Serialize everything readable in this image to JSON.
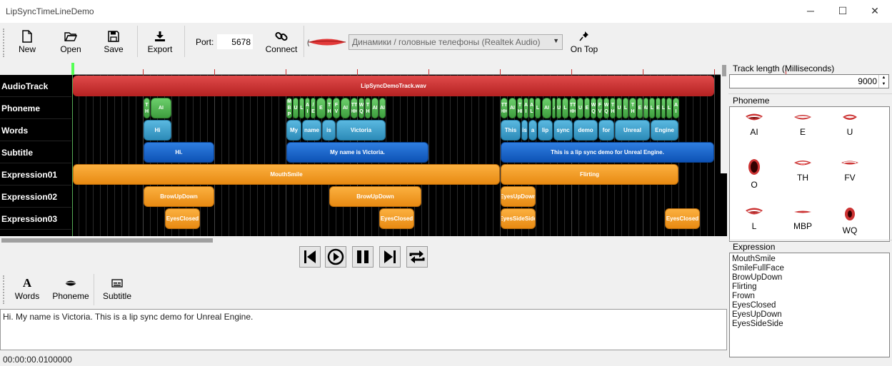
{
  "window": {
    "title": "LipSyncTimeLineDemo",
    "minimize": "─",
    "maximize": "☐",
    "close": "✕"
  },
  "toolbar": {
    "new_label": "New",
    "open_label": "Open",
    "save_label": "Save",
    "export_label": "Export",
    "port_label": "Port:",
    "port_value": "5678",
    "connect_label": "Connect",
    "audio_device": "Динамики / головные телефоны (Realtek Audio)",
    "ontop_label": "On Top"
  },
  "tracks": {
    "audio": "AudioTrack",
    "phoneme": "Phoneme",
    "words": "Words",
    "subtitle": "Subtitle",
    "expr1": "Expression01",
    "expr2": "Expression02",
    "expr3": "Expression03"
  },
  "clips": {
    "audio": "LipSyncDemoTrack.wav",
    "phonemes": [
      {
        "t": "T\nH"
      },
      {
        "t": "AI"
      },
      {
        "t": "M\nB\nP"
      },
      {
        "t": "U"
      },
      {
        "t": "L"
      },
      {
        "t": "A\nI"
      },
      {
        "t": "/\nE"
      },
      {
        "t": "E"
      },
      {
        "t": "T\nH"
      },
      {
        "t": "F\nV"
      },
      {
        "t": "AI"
      },
      {
        "t": "TT\nHH"
      },
      {
        "t": "W\nQ"
      },
      {
        "t": "T\nH"
      },
      {
        "t": "AI"
      },
      {
        "t": "AI"
      },
      {
        "t": "TT\nHH"
      },
      {
        "t": "AI"
      },
      {
        "t": "T\nHI"
      },
      {
        "t": "A\nI"
      },
      {
        "t": "A\nL"
      },
      {
        "t": "L"
      },
      {
        "t": "AI"
      },
      {
        "t": "Ls"
      },
      {
        "t": "U"
      },
      {
        "t": "L"
      },
      {
        "t": "TT\nHH"
      },
      {
        "t": "U"
      },
      {
        "t": "E"
      },
      {
        "t": "W\nQ"
      },
      {
        "t": "F\nV"
      },
      {
        "t": "W\nQ"
      },
      {
        "t": "T\nH"
      },
      {
        "t": "U"
      },
      {
        "t": "L"
      },
      {
        "t": "T\nH"
      },
      {
        "t": "E"
      },
      {
        "t": "AI"
      },
      {
        "t": "L"
      },
      {
        "t": "E"
      },
      {
        "t": "L"
      },
      {
        "t": "L"
      },
      {
        "t": "A\nI"
      },
      {
        "t": "L"
      },
      {
        "t": "E"
      }
    ],
    "words": [
      "Hi",
      "My",
      "name",
      "is",
      "Victoria",
      "This",
      "is",
      "a",
      "lip",
      "sync",
      "demo",
      "for",
      "Unreal",
      "Engine"
    ],
    "subtitles": [
      "Hi.",
      "My name is Victoria.",
      "This is a lip sync demo for Unreal Engine."
    ],
    "expr1": [
      "MouthSmile",
      "Flirting"
    ],
    "expr2": [
      "BrowUpDown",
      "BrowUpDown",
      "EyesUpDown"
    ],
    "expr3": [
      "EyesClosed",
      "EyesClosed",
      "EyesSideSide",
      "EyesClosed"
    ]
  },
  "bottom_toolbar": {
    "words_label": "Words",
    "phoneme_label": "Phoneme",
    "subtitle_label": "Subtitle"
  },
  "editor_text": "Hi. My name is Victoria. This is a lip sync demo for Unreal Engine.",
  "status_time": "00:00:00.0100000",
  "right_panel": {
    "track_length_label": "Track length (Milliseconds)",
    "track_length_value": "9000",
    "phoneme_label": "Phoneme",
    "phonemes": [
      "AI",
      "E",
      "U",
      "O",
      "TH",
      "FV",
      "L",
      "MBP",
      "WQ"
    ],
    "expression_label": "Expression",
    "expressions": [
      "MouthSmile",
      "SmileFullFace",
      "BrowUpDown",
      "Flirting",
      "Frown",
      "EyesClosed",
      "EyesUpDown",
      "EyesSideSide"
    ]
  },
  "colors": {
    "audio": "#c93030",
    "phoneme": "#4caf50",
    "word": "#3aa0cc",
    "subtitle": "#1565c0",
    "expression": "#f39a1e",
    "timeline_bg": "#000000"
  }
}
